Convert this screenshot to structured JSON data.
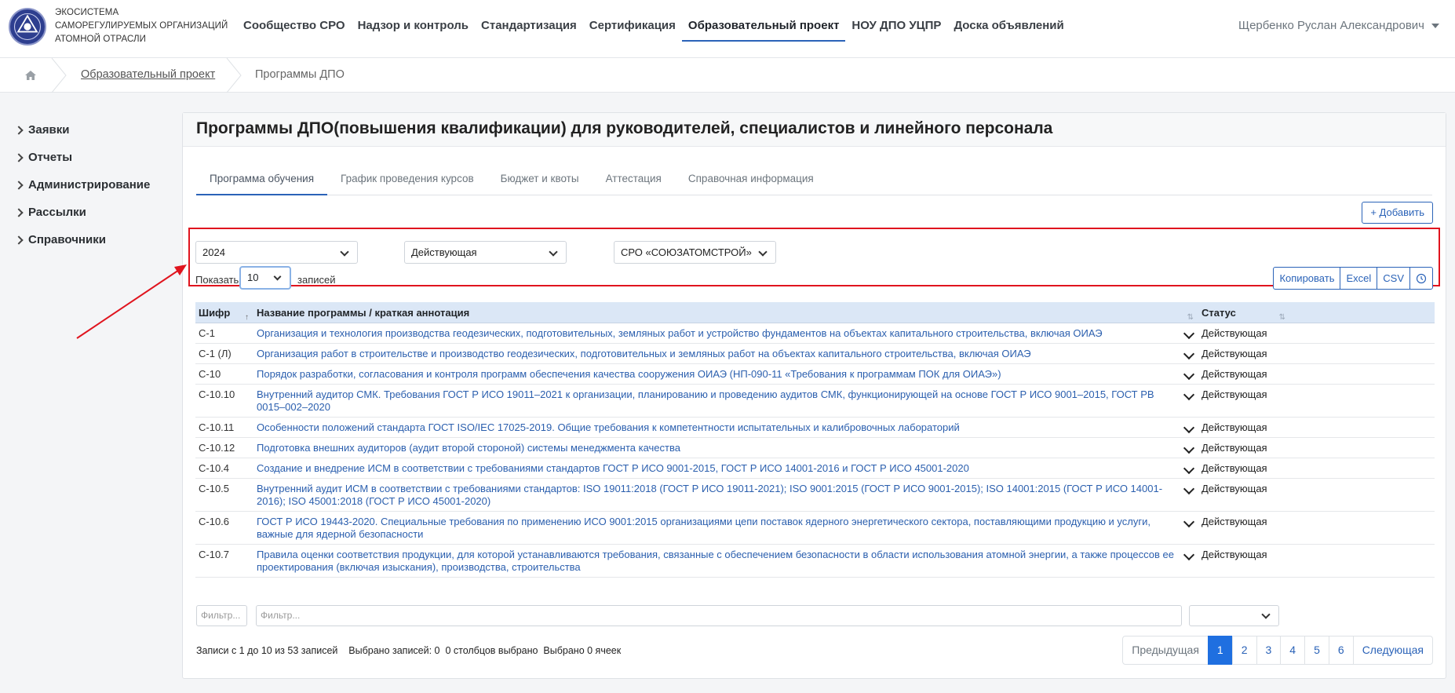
{
  "brand": {
    "line1": "ЭКОСИСТЕМА",
    "line2": "САМОРЕГУЛИРУЕМЫХ ОРГАНИЗАЦИЙ",
    "line3": "АТОМНОЙ ОТРАСЛИ"
  },
  "nav": [
    "Сообщество СРО",
    "Надзор и контроль",
    "Стандартизация",
    "Сертификация",
    "Образовательный проект",
    "НОУ ДПО УЦПР",
    "Доска объявлений"
  ],
  "nav_active": "Образовательный проект",
  "user": "Щербенко Руслан Александрович",
  "breadcrumb": {
    "link": "Образовательный проект",
    "current": "Программы ДПО"
  },
  "sidebar": [
    "Заявки",
    "Отчеты",
    "Администрирование",
    "Рассылки",
    "Справочники"
  ],
  "page_title": "Программы ДПО(повышения квалификации) для руководителей, специалистов и линейного персонала",
  "tabs": [
    "Программа обучения",
    "График проведения курсов",
    "Бюджет и квоты",
    "Аттестация",
    "Справочная информация"
  ],
  "add_button": "+ Добавить",
  "filters": {
    "year": "2024",
    "status": "Действующая",
    "sro": "СРО «СОЮЗАТОМСТРОЙ»"
  },
  "length": {
    "label_before": "Показать",
    "value": "10",
    "label_after": "записей"
  },
  "export": [
    "Копировать",
    "Excel",
    "CSV"
  ],
  "table": {
    "headers": {
      "code": "Шифр",
      "name": "Название программы / краткая аннотация",
      "status": "Статус"
    },
    "rows": [
      {
        "code": "С-1",
        "name": "Организация и технология производства геодезических, подготовительных, земляных работ и устройство фундаментов на объектах капитального строительства, включая ОИАЭ",
        "status": "Действующая"
      },
      {
        "code": "С-1 (Л)",
        "name": "Организация работ в строительстве и производство геодезических, подготовительных и земляных работ на объектах капитального строительства, включая ОИАЭ",
        "status": "Действующая"
      },
      {
        "code": "С-10",
        "name": "Порядок разработки, согласования и контроля программ обеспечения качества сооружения ОИАЭ (НП-090-11 «Требования к программам ПОК для ОИАЭ»)",
        "status": "Действующая"
      },
      {
        "code": "С-10.10",
        "name": "Внутренний аудитор СМК. Требования ГОСТ Р ИСО 19011–2021 к организации, планированию и проведению аудитов СМК, функционирующей на основе ГОСТ Р ИСО 9001–2015, ГОСТ РВ 0015–002–2020",
        "status": "Действующая"
      },
      {
        "code": "С-10.11",
        "name": "Особенности положений стандарта ГОСТ ISO/IEC 17025-2019. Общие требования к компетентности испытательных и калибровочных лабораторий",
        "status": "Действующая"
      },
      {
        "code": "С-10.12",
        "name": "Подготовка внешних аудиторов (аудит второй стороной) системы менеджмента качества",
        "status": "Действующая"
      },
      {
        "code": "С-10.4",
        "name": "Создание и внедрение ИСМ в соответствии с требованиями стандартов ГОСТ Р ИСО 9001-2015, ГОСТ Р ИСО 14001-2016 и ГОСТ Р ИСО 45001-2020",
        "status": "Действующая"
      },
      {
        "code": "С-10.5",
        "name": "Внутренний аудит ИСМ в соответствии с требованиями стандартов: ISO 19011:2018 (ГОСТ Р ИСО 19011-2021); ISO 9001:2015 (ГОСТ Р ИСО 9001-2015); ISO 14001:2015 (ГОСТ Р ИСО 14001-2016); ISO 45001:2018 (ГОСТ Р ИСО 45001-2020)",
        "status": "Действующая"
      },
      {
        "code": "С-10.6",
        "name": "ГОСТ Р ИСО 19443-2020. Специальные требования по применению ИСО 9001:2015 организациями цепи поставок ядерного энергетического сектора, поставляющими продукцию и услуги, важные для ядерной безопасности",
        "status": "Действующая"
      },
      {
        "code": "С-10.7",
        "name": "Правила оценки соответствия продукции, для которой устанавливаются требования, связанные с обеспечением безопасности в области использования атомной энергии, а также процессов ее проектирования (включая изыскания), производства, строительства",
        "status": "Действующая"
      }
    ]
  },
  "filter_placeholder": "Фильтр...",
  "info": "Записи с 1 до 10 из 53 записей    Выбрано записей: 0  0 столбцов выбрано  Выбрано 0 ячеек",
  "pagination": {
    "prev": "Предыдущая",
    "pages": [
      "1",
      "2",
      "3",
      "4",
      "5",
      "6"
    ],
    "next": "Следующая",
    "active": "1"
  },
  "colors": {
    "accent": "#2b63b8",
    "link": "#2b5fae",
    "highlight": "#e0141e",
    "header_bg": "#dbe7f6"
  }
}
